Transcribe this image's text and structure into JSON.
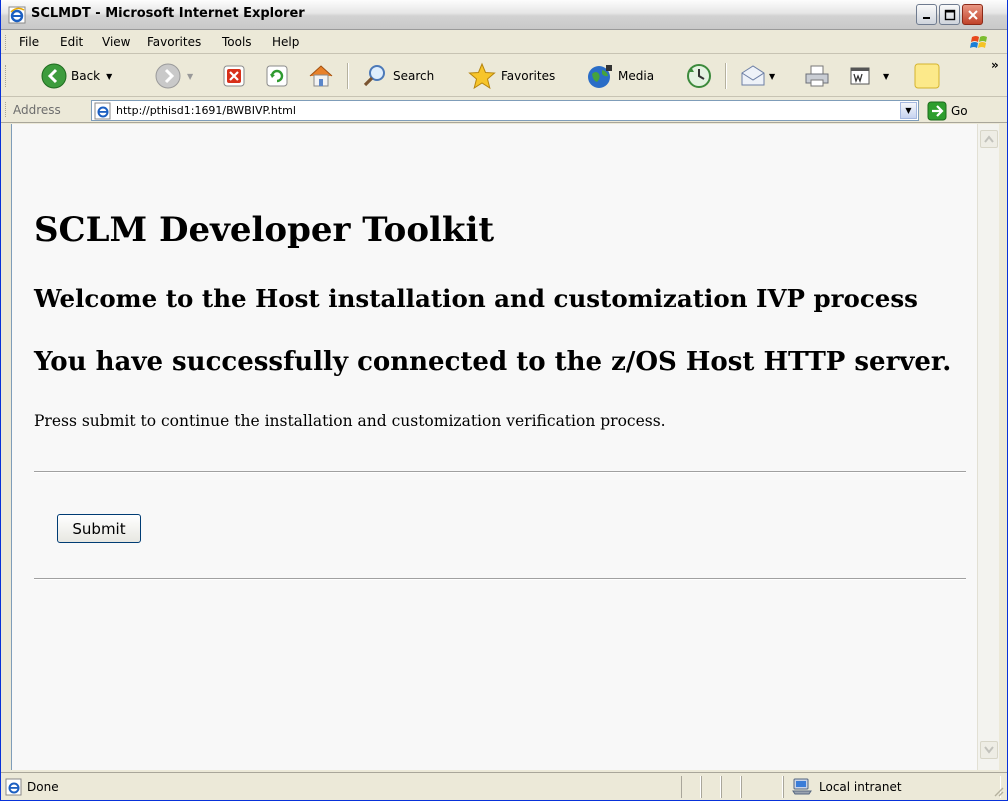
{
  "window": {
    "title": "SCLMDT - Microsoft Internet Explorer"
  },
  "menu": {
    "items": [
      {
        "label": "File",
        "accel": "F"
      },
      {
        "label": "Edit",
        "accel": "E"
      },
      {
        "label": "View",
        "accel": "V"
      },
      {
        "label": "Favorites",
        "accel": "a"
      },
      {
        "label": "Tools",
        "accel": "T"
      },
      {
        "label": "Help",
        "accel": "H"
      }
    ]
  },
  "toolbar": {
    "back_label": "Back",
    "search_label": "Search",
    "favorites_label": "Favorites",
    "media_label": "Media",
    "overflow": "»"
  },
  "address": {
    "label": "Address",
    "url": "http://pthisd1:1691/BWBIVP.html",
    "go_label": "Go"
  },
  "page": {
    "heading": "SCLM Developer Toolkit",
    "subheading_1": "Welcome to the Host installation and customization IVP process",
    "subheading_2": "You have successfully connected to the z/OS Host HTTP server.",
    "instruction": "Press submit to continue the installation and customization verification process.",
    "submit_label": "Submit"
  },
  "status": {
    "text": "Done",
    "zone": "Local intranet"
  },
  "colors": {
    "ie_blue": "#1c5fc1",
    "go_green": "#2e9e2e",
    "page_background": "#f8f8f8"
  }
}
